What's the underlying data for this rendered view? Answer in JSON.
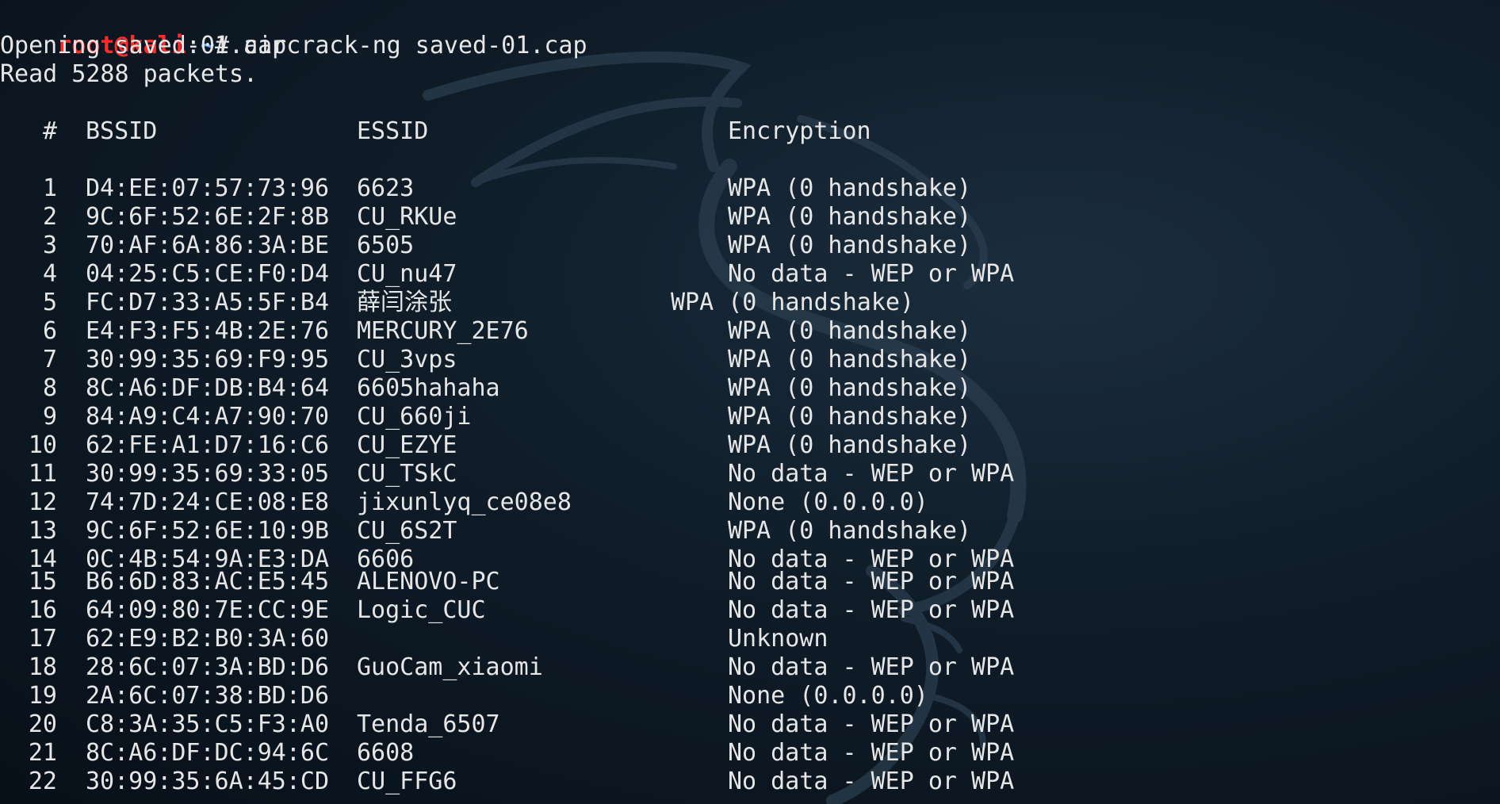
{
  "terminal": {
    "prompt": {
      "user_host": "root@kali",
      "separator": ":",
      "path": "~",
      "symbol": "# ",
      "command": "aircrack-ng saved-01.cap"
    },
    "output_lines": [
      "Opening saved-01.cap",
      "Read 5288 packets."
    ],
    "table": {
      "headers": {
        "num": "#",
        "bssid": "BSSID",
        "essid": "ESSID",
        "encryption": "Encryption"
      },
      "rows": [
        {
          "num": "1",
          "bssid": "D4:EE:07:57:73:96",
          "essid": "6623",
          "encryption": "WPA (0 handshake)"
        },
        {
          "num": "2",
          "bssid": "9C:6F:52:6E:2F:8B",
          "essid": "CU_RKUe",
          "encryption": "WPA (0 handshake)"
        },
        {
          "num": "3",
          "bssid": "70:AF:6A:86:3A:BE",
          "essid": "6505",
          "encryption": "WPA (0 handshake)"
        },
        {
          "num": "4",
          "bssid": "04:25:C5:CE:F0:D4",
          "essid": "CU_nu47",
          "encryption": "No data - WEP or WPA"
        },
        {
          "num": "5",
          "bssid": "FC:D7:33:A5:5F:B4",
          "essid": "薛闫涂张",
          "encryption": "WPA (0 handshake)"
        },
        {
          "num": "6",
          "bssid": "E4:F3:F5:4B:2E:76",
          "essid": "MERCURY_2E76",
          "encryption": "WPA (0 handshake)"
        },
        {
          "num": "7",
          "bssid": "30:99:35:69:F9:95",
          "essid": "CU_3vps",
          "encryption": "WPA (0 handshake)"
        },
        {
          "num": "8",
          "bssid": "8C:A6:DF:DB:B4:64",
          "essid": "6605hahaha",
          "encryption": "WPA (0 handshake)"
        },
        {
          "num": "9",
          "bssid": "84:A9:C4:A7:90:70",
          "essid": "CU_660ji",
          "encryption": "WPA (0 handshake)"
        },
        {
          "num": "10",
          "bssid": "62:FE:A1:D7:16:C6",
          "essid": "CU_EZYE",
          "encryption": "WPA (0 handshake)"
        },
        {
          "num": "11",
          "bssid": "30:99:35:69:33:05",
          "essid": "CU_TSkC",
          "encryption": "No data - WEP or WPA"
        },
        {
          "num": "12",
          "bssid": "74:7D:24:CE:08:E8",
          "essid": "jixunlyq_ce08e8",
          "encryption": "None (0.0.0.0)"
        },
        {
          "num": "13",
          "bssid": "9C:6F:52:6E:10:9B",
          "essid": "CU_6S2T",
          "encryption": "WPA (0 handshake)"
        },
        {
          "num": "14",
          "bssid": "0C:4B:54:9A:E3:DA",
          "essid": "6606",
          "encryption": "No data - WEP or WPA"
        },
        {
          "num": "15",
          "bssid": "B6:6D:83:AC:E5:45",
          "essid": "ALENOVO-PC",
          "encryption": "No data - WEP or WPA"
        },
        {
          "num": "16",
          "bssid": "64:09:80:7E:CC:9E",
          "essid": "Logic_CUC",
          "encryption": "No data - WEP or WPA"
        },
        {
          "num": "17",
          "bssid": "62:E9:B2:B0:3A:60",
          "essid": "",
          "encryption": "Unknown"
        },
        {
          "num": "18",
          "bssid": "28:6C:07:3A:BD:D6",
          "essid": "GuoCam_xiaomi",
          "encryption": "No data - WEP or WPA"
        },
        {
          "num": "19",
          "bssid": "2A:6C:07:38:BD:D6",
          "essid": "",
          "encryption": "None (0.0.0.0)"
        },
        {
          "num": "20",
          "bssid": "C8:3A:35:C5:F3:A0",
          "essid": "Tenda_6507",
          "encryption": "No data - WEP or WPA"
        },
        {
          "num": "21",
          "bssid": "8C:A6:DF:DC:94:6C",
          "essid": "6608",
          "encryption": "No data - WEP or WPA"
        },
        {
          "num": "22",
          "bssid": "30:99:35:6A:45:CD",
          "essid": "CU_FFG6",
          "encryption": "No data - WEP or WPA"
        }
      ]
    }
  },
  "colors": {
    "background": "#0f1c28",
    "text": "#e6e6e6",
    "prompt_user": "#ff2b2b",
    "prompt_path": "#5fa9ff"
  },
  "icons": {
    "watermark": "kali-dragon-watermark-icon"
  }
}
